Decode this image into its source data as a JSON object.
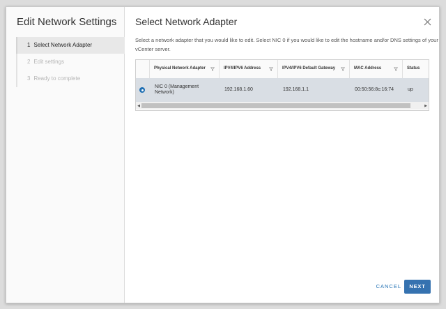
{
  "wizard": {
    "title": "Edit Network Settings",
    "steps": [
      {
        "num": "1",
        "label": "Select Network Adapter",
        "state": "active"
      },
      {
        "num": "2",
        "label": "Edit settings",
        "state": "disabled"
      },
      {
        "num": "3",
        "label": "Ready to complete",
        "state": "disabled"
      }
    ]
  },
  "page": {
    "title": "Select Network Adapter",
    "description": "Select a network adapter that you would like to edit. Select NIC 0 if you would like to edit the hostname and/or DNS settings of your vCenter server."
  },
  "grid": {
    "columns": [
      {
        "label": "Physical Network Adapter"
      },
      {
        "label": "IPV4/IPV6 Address"
      },
      {
        "label": "IPV4/IPV6 Default Gateway"
      },
      {
        "label": "MAC Address"
      },
      {
        "label": "Status"
      }
    ],
    "rows": [
      {
        "selected": true,
        "adapter": "NIC 0 (Management Network)",
        "address": "192.168.1.60",
        "gateway": "192.168.1.1",
        "mac": "00:50:56:8c:16:74",
        "status": "up"
      }
    ]
  },
  "footer": {
    "cancel_label": "CANCEL",
    "next_label": "NEXT"
  },
  "colors": {
    "accent": "#3572b0",
    "selected_row": "#d9dee4"
  },
  "icons": {
    "close": "close-icon",
    "filter": "filter-icon",
    "radio": "radio-selected-icon",
    "scroll_left": "scroll-left-arrow-icon",
    "scroll_right": "scroll-right-arrow-icon"
  }
}
